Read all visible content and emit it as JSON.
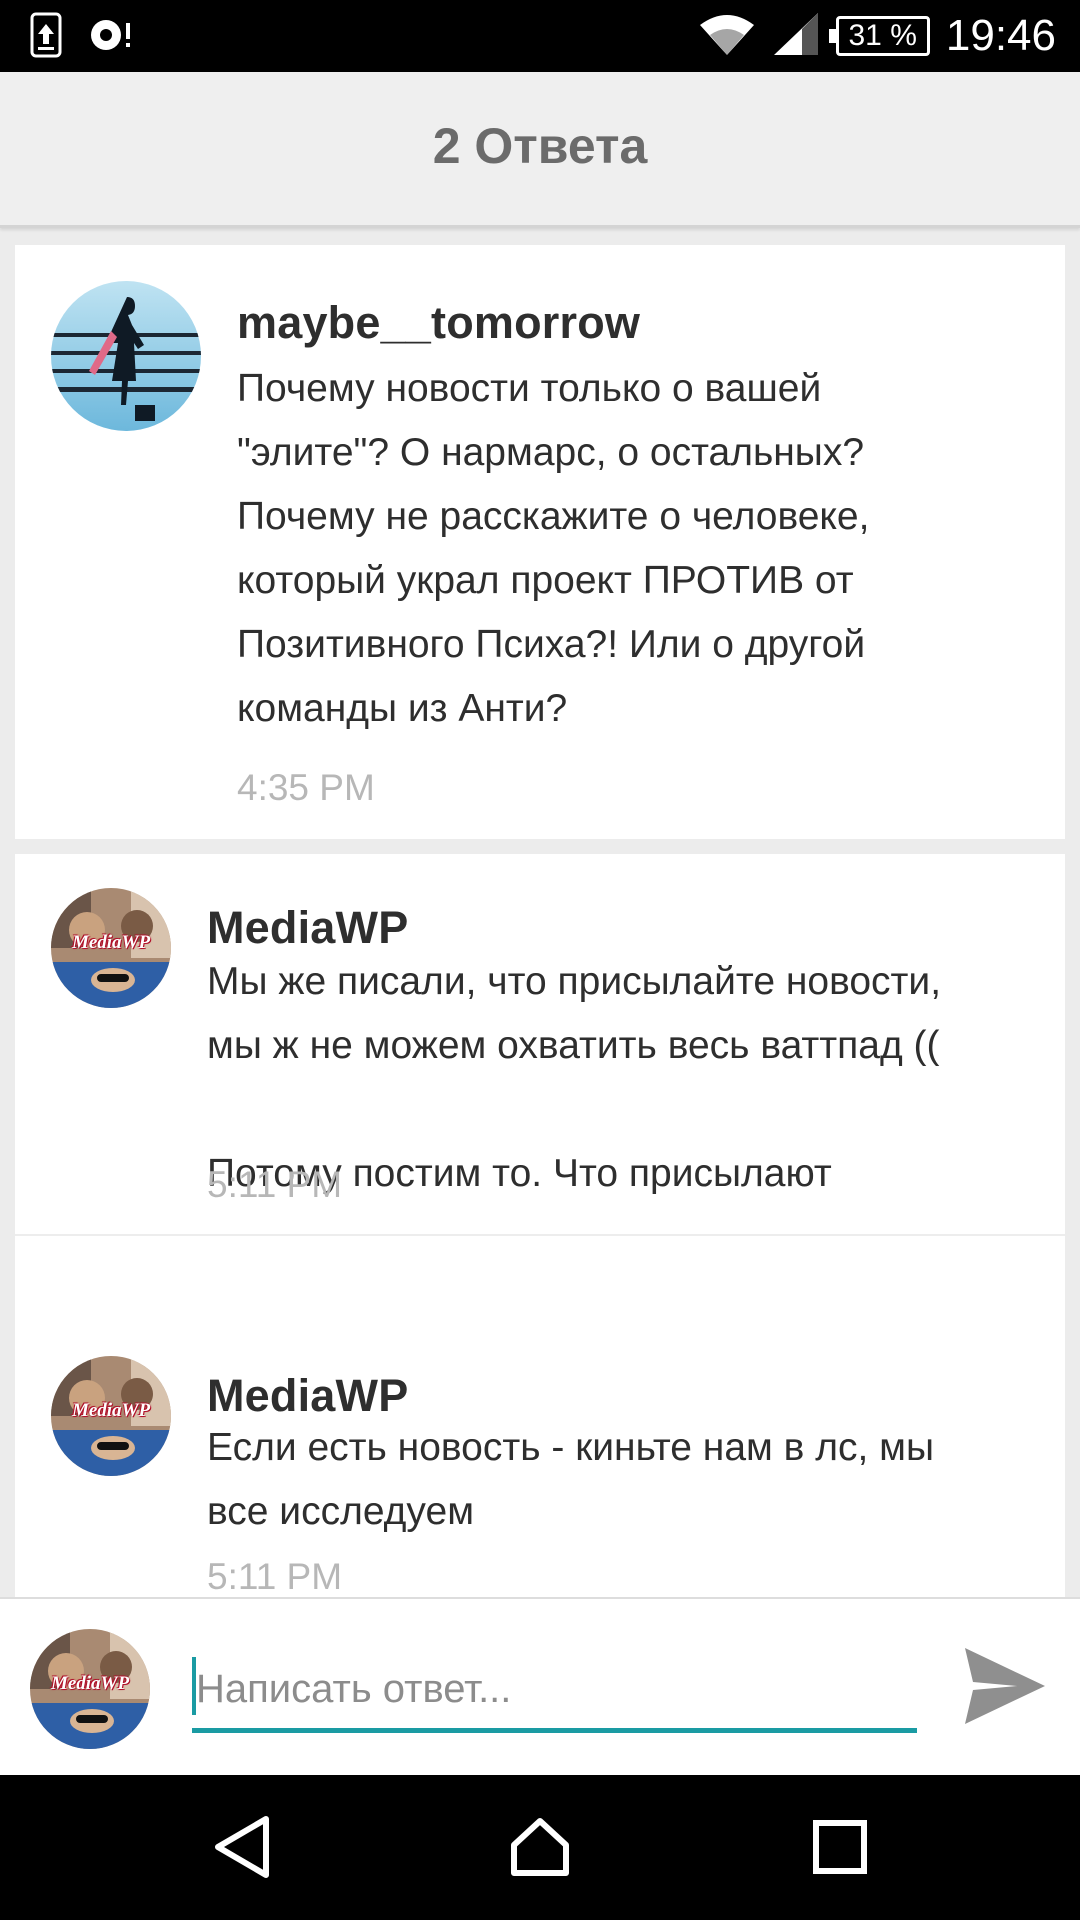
{
  "status_bar": {
    "battery": "31 %",
    "time": "19:46",
    "icons": [
      "upload-icon",
      "circle-notification-icon",
      "wifi-icon",
      "signal-icon",
      "battery-icon"
    ]
  },
  "header": {
    "title": "2 Ответа"
  },
  "root_comment": {
    "author": "maybe__tomorrow",
    "body": "Почему новости только о вашей\n\"элите\"? О нармарс, о остальных?\nПочему не расскажите о человеке,\nкоторый украл проект ПРОТИВ от\nПозитивного Психа?! Или о другой\nкоманды из Анти?",
    "time": "4:35 PM"
  },
  "replies": [
    {
      "author": "MediaWP",
      "avatar_label": "MediaWP",
      "body": "Мы же писали, что присылайте новости,\nмы ж не можем охватить весь ваттпад ((\n\nПотому постим то. Что присылают",
      "time": "5:11 PM"
    },
    {
      "author": "MediaWP",
      "avatar_label": "MediaWP",
      "body": "Если есть новость - киньте нам в лс, мы\nвсе исследуем",
      "time": "5:11 PM"
    }
  ],
  "reply_bar": {
    "avatar_label": "MediaWP",
    "placeholder": "Написать ответ...",
    "value": ""
  },
  "nav": {
    "icons": [
      "back-icon",
      "home-icon",
      "recents-icon"
    ]
  },
  "colors": {
    "accent": "#1a9ba3",
    "header_bg": "#efefef",
    "text": "#2e2e2e",
    "time": "#b7b7b7"
  }
}
